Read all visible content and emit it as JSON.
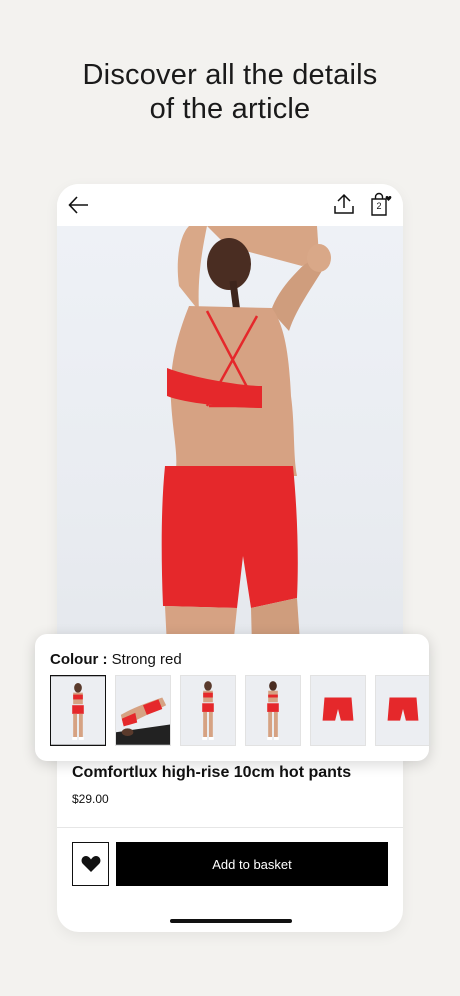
{
  "promo": {
    "line1": "Discover all the details",
    "line2": "of the article"
  },
  "header": {
    "bag_count": "2"
  },
  "product": {
    "title": "Comfortlux high-rise 10cm hot pants",
    "price": "$29.00",
    "add_to_basket": "Add to basket"
  },
  "colour": {
    "label": "Colour :",
    "value": "Strong red",
    "selected_index": 0
  },
  "colors": {
    "accent_red": "#e5282b",
    "button_black": "#000000"
  }
}
